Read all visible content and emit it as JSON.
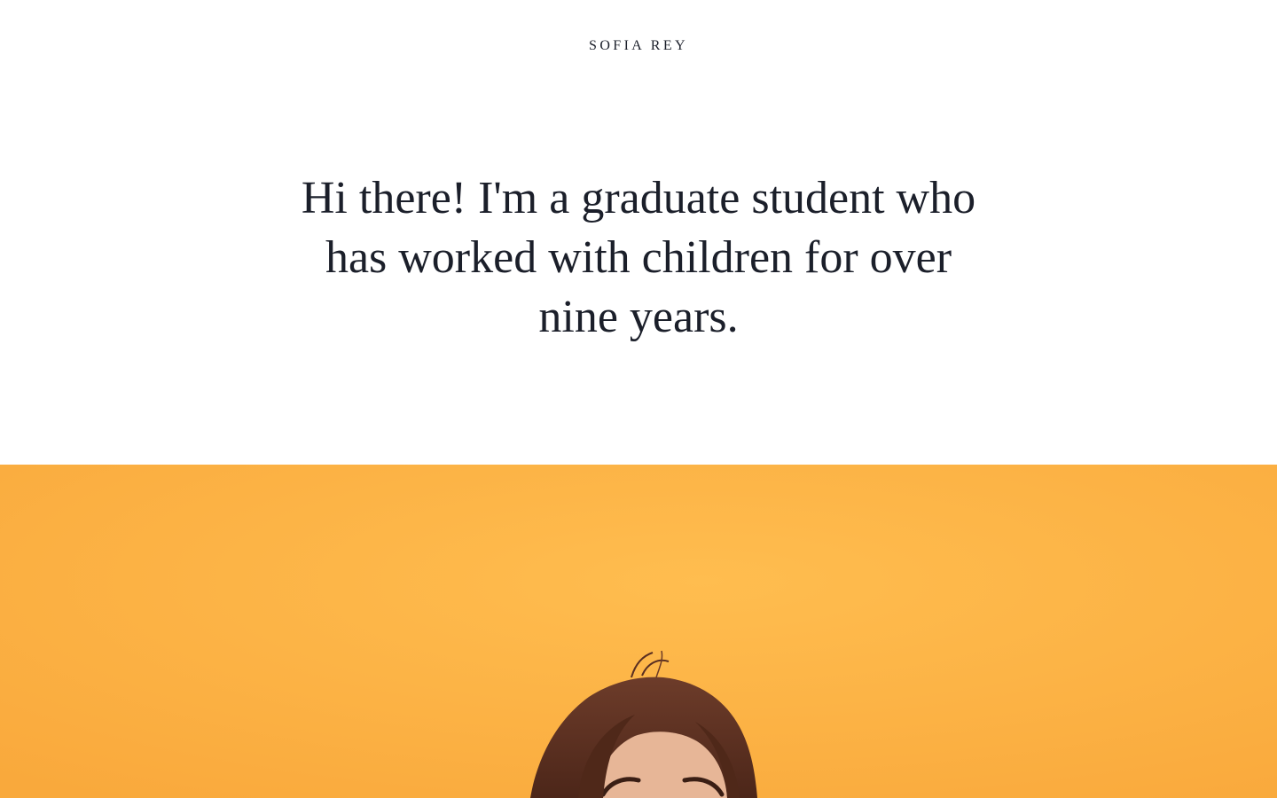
{
  "site": {
    "title": "SOFIA REY"
  },
  "intro": {
    "text": "Hi there! I'm a graduate student who has worked with children for over nine years."
  },
  "hero": {
    "image": "portrait-photo",
    "background_color": "#fdb345",
    "hair_color": "#5e3324",
    "skin_color": "#e7b697"
  }
}
